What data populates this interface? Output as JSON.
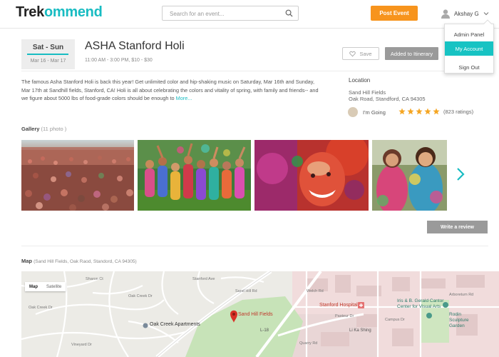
{
  "header": {
    "logo": {
      "part1": "Trek",
      "part2": "ommend"
    },
    "search_placeholder": "Search for an event...",
    "post_event": "Post Event",
    "user_name": "Akshay G"
  },
  "user_menu": {
    "items": [
      "Admin Panel",
      "My Account",
      "Sign Out"
    ],
    "active": "My Account"
  },
  "event": {
    "days": "Sat - Sun",
    "date_range": "Mar 16 - Mar 17",
    "title": "ASHA Stanford Holi",
    "subtitle": "11:00 AM - 3:00 PM, $10 - $30",
    "save": "Save",
    "itinerary": "Added to Itinerary",
    "description": "The famous Asha Stanford Holi is back this year! Get unlimited color and hip-shaking music on Saturday, Mar 16th and Sunday, Mar 17th at Sandhill fields, Stanford, CA! Holi is all about celebrating the colors and vitality of spring, with family and friends-- and we figure about 5000 lbs of food-grade colors should be enough to",
    "more": "More..."
  },
  "location": {
    "label": "Location",
    "name": "Sand Hill Fields",
    "address": "Oak Road, Standford, CA 94305",
    "going": "I'm Going",
    "stars": 5,
    "ratings": "(823 ratings)"
  },
  "gallery": {
    "label": "Gallery",
    "count": "(11 photo )"
  },
  "review_button": "Write a review",
  "map": {
    "label": "Map",
    "address": "(Sand Hill Fields, Oak Raod, Standord, CA 94305)",
    "types": [
      "Map",
      "Satellite"
    ],
    "labels": {
      "oak_creek": "Oak Creek Apartments",
      "sand_hill": "Sand Hill Fields",
      "hospital": "Stanford Hospital",
      "cantor": [
        "Iris & B. Gerald Cantor",
        "Center for Visual Arts"
      ],
      "rodin": [
        "Rodin",
        "Sculpture",
        "Garden"
      ],
      "li_ka_shing": "Li Ka Shing",
      "l18": "L-18",
      "roads": [
        "Oak Creek Dr",
        "Sand Hill Rd",
        "Welch Rd",
        "Pasteur Dr",
        "Campus Dr",
        "Arboretum Rd",
        "Sharon Ct",
        "Quarry Rd",
        "Vineyard Dr",
        "Oak Creek Dr",
        "Stanford Ave"
      ]
    }
  },
  "colors": {
    "accent": "#18bcc2",
    "orange": "#f7941d",
    "star": "#f5a623",
    "gray_button": "#9a9a9a",
    "menu_active": "#17c3c3",
    "map_pin": "#d93025"
  }
}
